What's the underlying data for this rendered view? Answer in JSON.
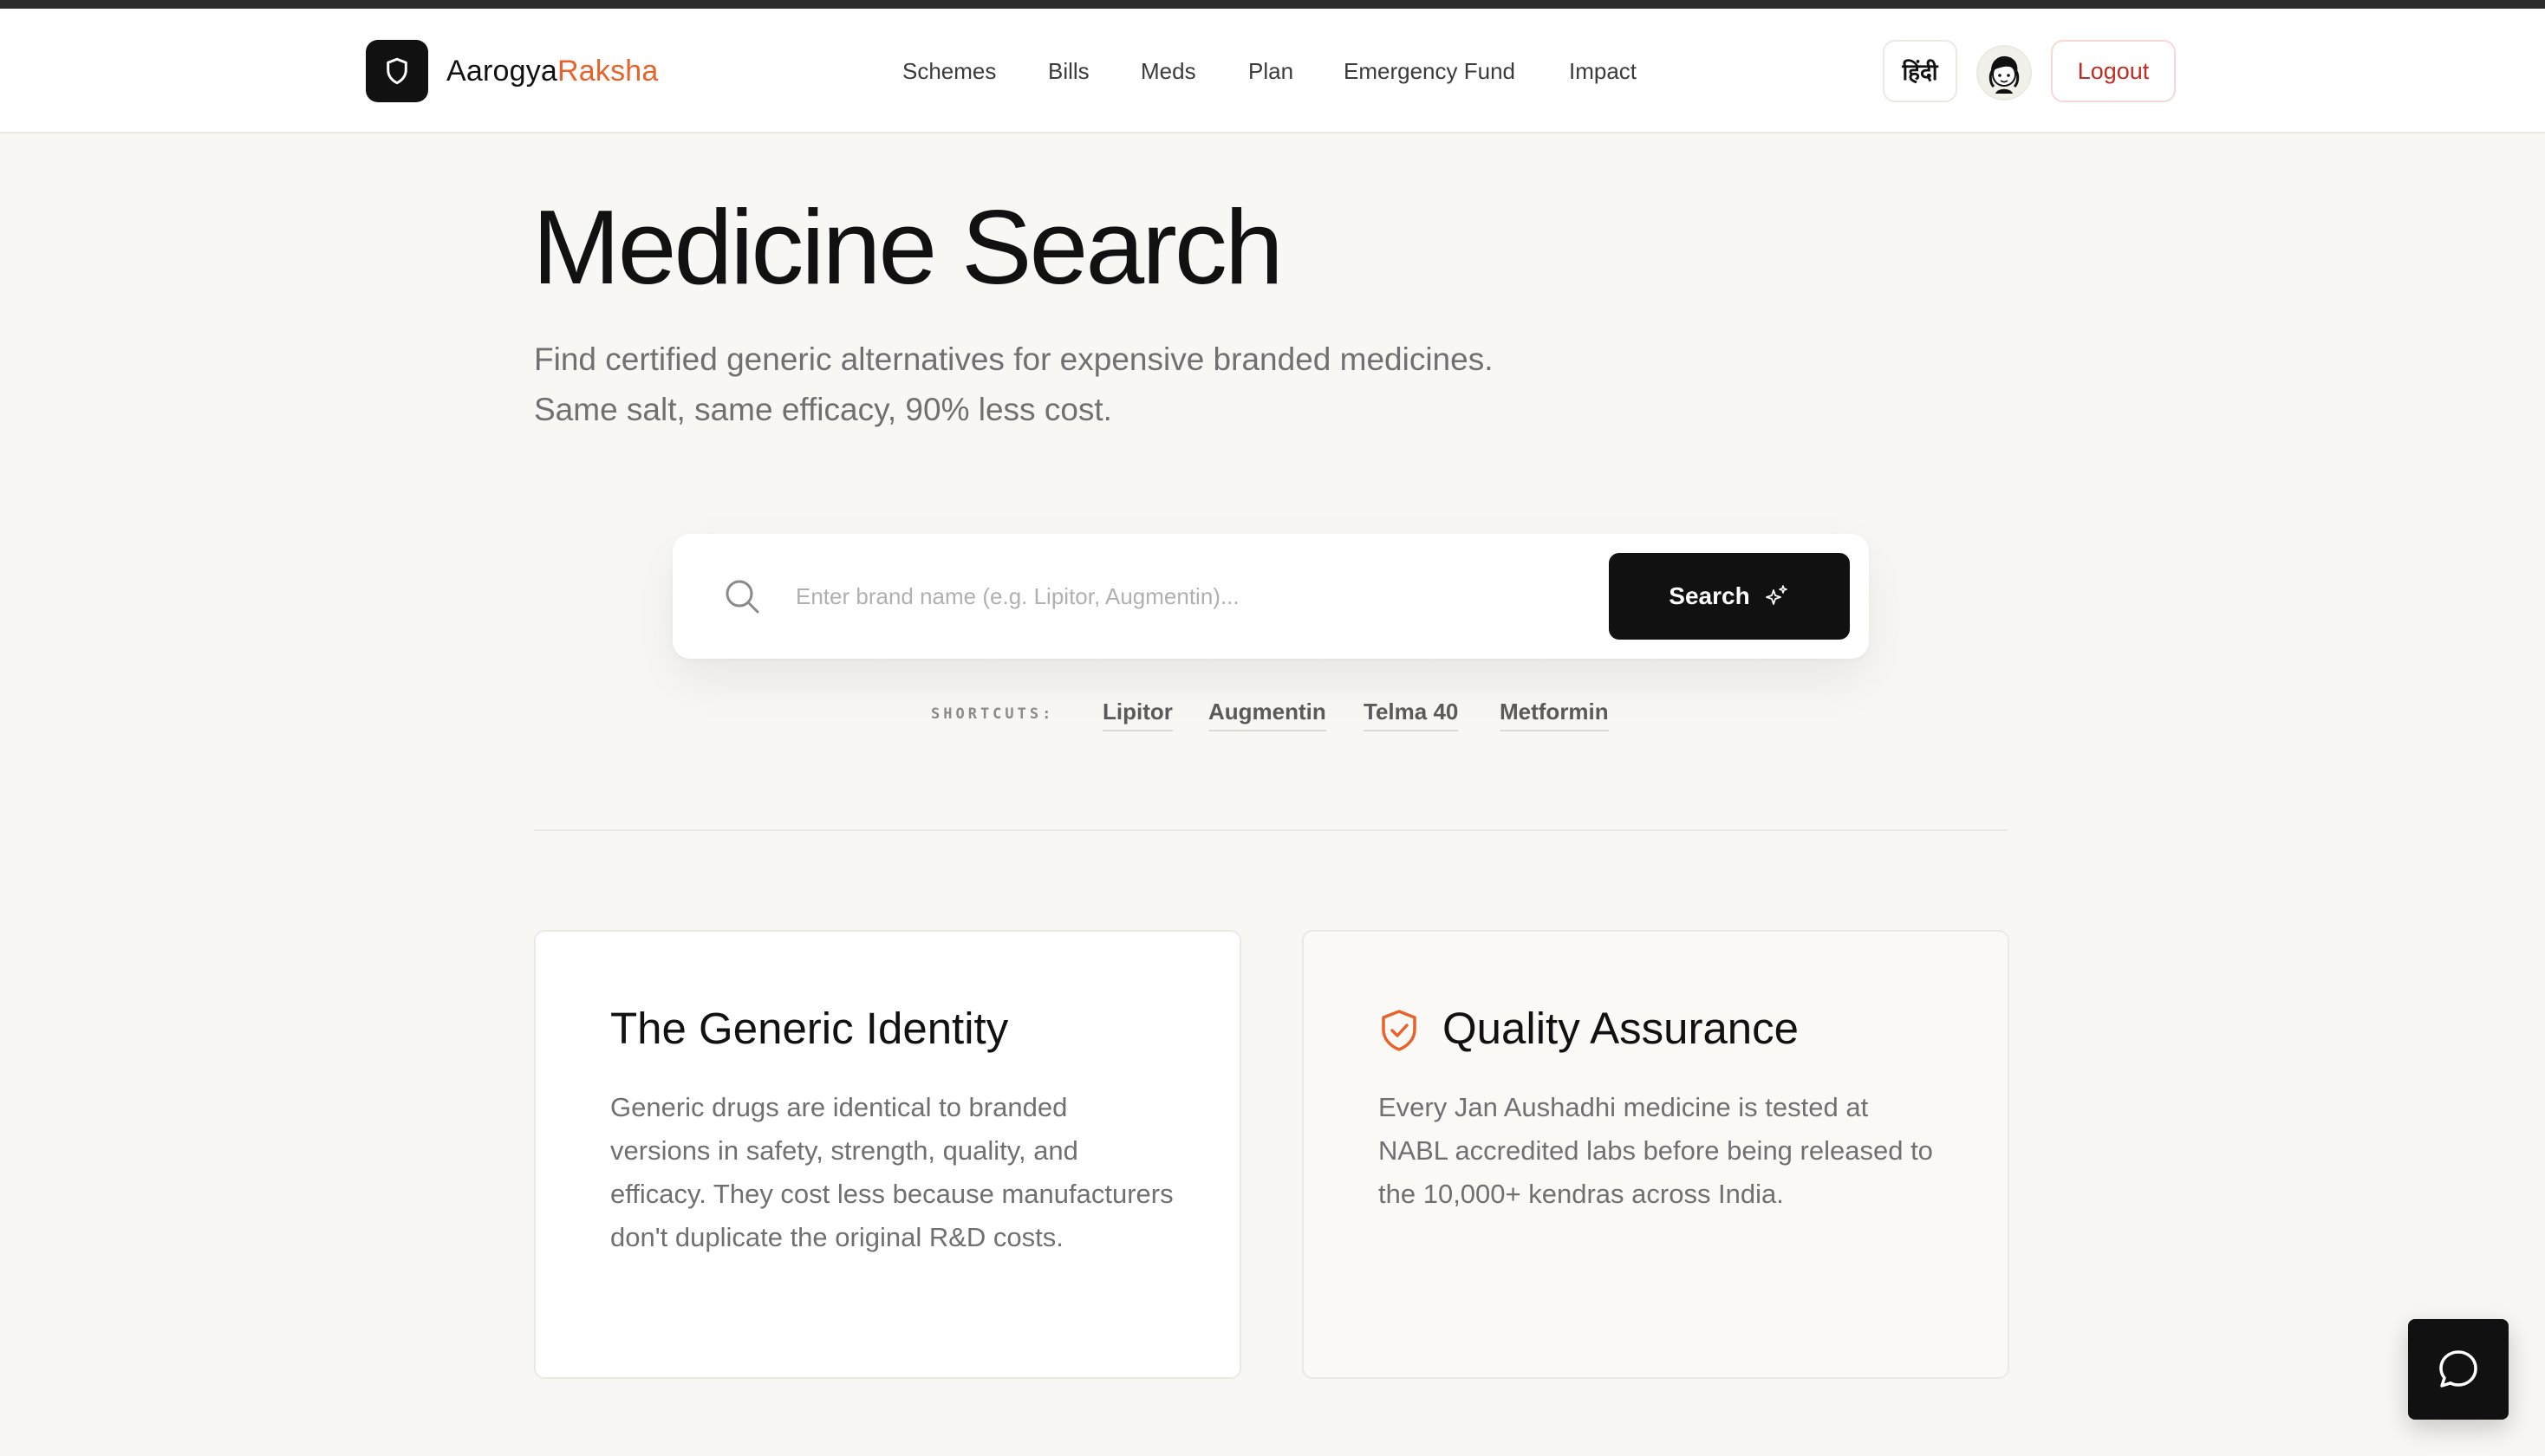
{
  "brand": {
    "part1": "Aarogya",
    "part2": "Raksha"
  },
  "nav": {
    "items": [
      "Schemes",
      "Bills",
      "Meds",
      "Plan",
      "Emergency Fund",
      "Impact"
    ]
  },
  "header": {
    "language_label": "हिंदी",
    "logout_label": "Logout"
  },
  "hero": {
    "title": "Medicine Search",
    "subtitle_line1": "Find certified generic alternatives for expensive branded medicines.",
    "subtitle_line2": "Same salt, same efficacy, 90% less cost."
  },
  "search": {
    "placeholder": "Enter brand name (e.g. Lipitor, Augmentin)...",
    "value": "",
    "button_label": "Search"
  },
  "shortcuts": {
    "label": "SHORTCUTS:",
    "items": [
      "Lipitor",
      "Augmentin",
      "Telma 40",
      "Metformin"
    ]
  },
  "cards": [
    {
      "title": "The Generic Identity",
      "body": "Generic drugs are identical to branded versions in safety, strength, quality, and efficacy. They cost less because manufacturers don't duplicate the original R&D costs."
    },
    {
      "title": "Quality Assurance",
      "body": "Every Jan Aushadhi medicine is tested at NABL accredited labs before being released to the 10,000+ kendras across India."
    }
  ],
  "colors": {
    "accent": "#e8632b",
    "background": "#f8f7f4",
    "primary_button": "#111111",
    "logout_text": "#c42a1f"
  },
  "icons": {
    "logo": "shield-icon",
    "search": "search-icon",
    "search_button": "sparkles-icon",
    "card": "shield-check-icon",
    "chat": "chat-bubble-icon",
    "avatar": "avatar"
  }
}
